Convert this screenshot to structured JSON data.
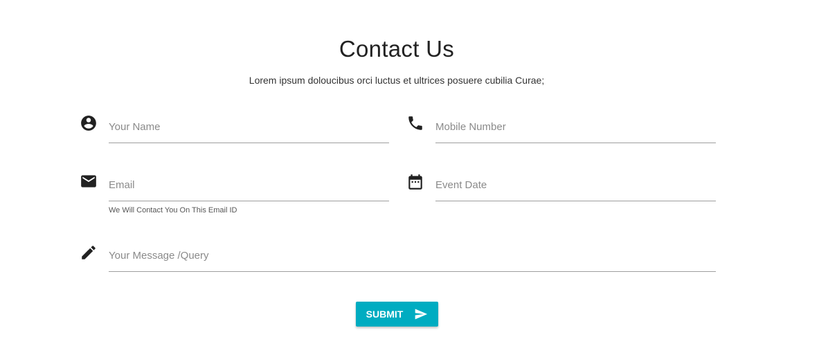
{
  "header": {
    "title": "Contact Us",
    "subtitle": "Lorem ipsum doloucibus orci luctus et ultrices posuere cubilia Curae;"
  },
  "form": {
    "name_placeholder": "Your Name",
    "mobile_placeholder": "Mobile Number",
    "email_placeholder": "Email",
    "email_hint": "We Will Contact You On This Email ID",
    "event_date_placeholder": "Event Date",
    "message_placeholder": "Your Message /Query",
    "submit_label": "SUBMIT"
  },
  "icons": {
    "name": "account-circle-icon",
    "mobile": "phone-icon",
    "email": "mail-icon",
    "event_date": "calendar-icon",
    "message": "pencil-icon",
    "submit": "send-icon"
  },
  "colors": {
    "accent": "#00acc1",
    "icon": "#212121",
    "underline": "#9e9e9e"
  }
}
